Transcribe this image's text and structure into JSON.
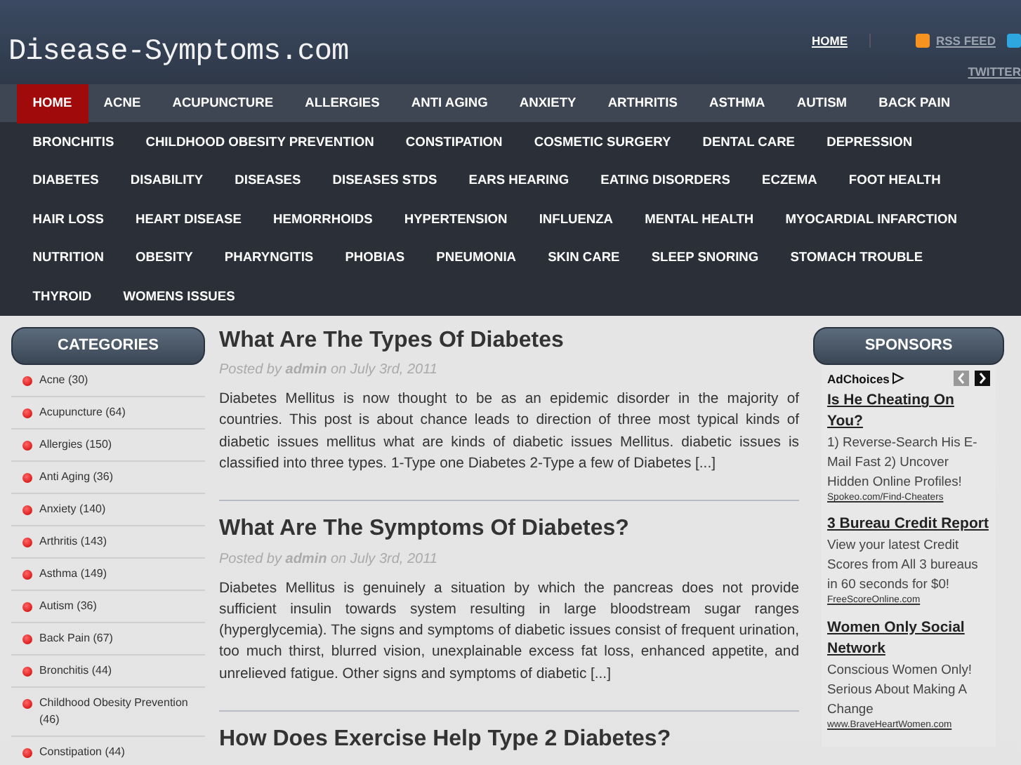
{
  "header": {
    "logo": "Disease-Symptoms.com",
    "top_links": [
      {
        "label": "HOME",
        "kind": "text"
      },
      {
        "label": "RSS FEED",
        "kind": "rss"
      },
      {
        "label": "TWITTER",
        "kind": "twitter"
      }
    ]
  },
  "nav": [
    {
      "label": "HOME",
      "selected": true
    },
    {
      "label": "ACNE",
      "selected": false
    },
    {
      "label": "ACUPUNCTURE",
      "selected": false
    },
    {
      "label": "ALLERGIES",
      "selected": false
    },
    {
      "label": "ANTI AGING",
      "selected": false
    },
    {
      "label": "ANXIETY",
      "selected": false
    },
    {
      "label": "ARTHRITIS",
      "selected": false
    },
    {
      "label": "ASTHMA",
      "selected": false
    },
    {
      "label": "AUTISM",
      "selected": false
    },
    {
      "label": "BACK PAIN",
      "selected": false
    },
    {
      "label": "BRONCHITIS",
      "selected": false
    },
    {
      "label": "CHILDHOOD OBESITY PREVENTION",
      "selected": false
    },
    {
      "label": "CONSTIPATION",
      "selected": false
    },
    {
      "label": "COSMETIC SURGERY",
      "selected": false
    },
    {
      "label": "DENTAL CARE",
      "selected": false
    },
    {
      "label": "DEPRESSION",
      "selected": false
    },
    {
      "label": "DIABETES",
      "selected": false
    },
    {
      "label": "DISABILITY",
      "selected": false
    },
    {
      "label": "DISEASES",
      "selected": false
    },
    {
      "label": "DISEASES STDS",
      "selected": false
    },
    {
      "label": "EARS HEARING",
      "selected": false
    },
    {
      "label": "EATING DISORDERS",
      "selected": false
    },
    {
      "label": "ECZEMA",
      "selected": false
    },
    {
      "label": "FOOT HEALTH",
      "selected": false
    },
    {
      "label": "HAIR LOSS",
      "selected": false
    },
    {
      "label": "HEART DISEASE",
      "selected": false
    },
    {
      "label": "HEMORRHOIDS",
      "selected": false
    },
    {
      "label": "HYPERTENSION",
      "selected": false
    },
    {
      "label": "INFLUENZA",
      "selected": false
    },
    {
      "label": "MENTAL HEALTH",
      "selected": false
    },
    {
      "label": "MYOCARDIAL INFARCTION",
      "selected": false
    },
    {
      "label": "NUTRITION",
      "selected": false
    },
    {
      "label": "OBESITY",
      "selected": false
    },
    {
      "label": "PHARYNGITIS",
      "selected": false
    },
    {
      "label": "PHOBIAS",
      "selected": false
    },
    {
      "label": "PNEUMONIA",
      "selected": false
    },
    {
      "label": "SKIN CARE",
      "selected": false
    },
    {
      "label": "SLEEP SNORING",
      "selected": false
    },
    {
      "label": "STOMACH TROUBLE",
      "selected": false
    },
    {
      "label": "THYROID",
      "selected": false
    },
    {
      "label": "WOMENS ISSUES",
      "selected": false
    }
  ],
  "categories": {
    "title": "CATEGORIES",
    "items": [
      "Acne (30)",
      "Acupuncture (64)",
      "Allergies (150)",
      "Anti Aging (36)",
      "Anxiety (140)",
      "Arthritis (143)",
      "Asthma (149)",
      "Autism (36)",
      "Back Pain (67)",
      "Bronchitis (44)",
      "Childhood Obesity Prevention (46)",
      "Constipation (44)"
    ]
  },
  "posts": [
    {
      "title": "What Are The Types Of Diabetes",
      "meta": "Posted by **admin** on July 3rd, 2011",
      "excerpt": "Diabetes Mellitus is now thought to be as an epidemic disorder in the majority of countries. This post is about chance leads to direction of three most typical kinds of diabetic issues mellitus what are kinds of diabetic issues Mellitus. diabetic issues is classified into three types. 1-Type one Diabetes 2-Type a few of Diabetes [...]"
    },
    {
      "title": "What Are The Symptoms Of Diabetes?",
      "meta": "Posted by **admin** on July 3rd, 2011",
      "excerpt": "Diabetes Mellitus is genuinely a situation by which the pancreas does not provide sufficient insulin towards system resulting in large bloodstream sugar ranges (hyperglycemia). The signs and symptoms of diabetic issues consist of frequent urination, too much thirst, blurred vision, unexplainable excess fat loss, enhanced appetite, and unrelieved fatigue. Other signs and symptoms of diabetic [...]"
    },
    {
      "title": "How Does Exercise Help Type 2 Diabetes?"
    }
  ],
  "sponsors": {
    "title": "SPONSORS",
    "adchoices": "AdChoices",
    "ads": [
      {
        "title": "Is He Cheating On You?",
        "text": "1) Reverse-Search His E-Mail Fast 2) Uncover Hidden Online Profiles!",
        "url": "Spokeo.com/Find-Cheaters"
      },
      {
        "title": "3 Bureau Credit Report",
        "text": "View your latest Credit Scores from All 3 bureaus in 60 seconds for $0!",
        "url": "FreeScoreOnline.com"
      },
      {
        "title": "Women Only Social Network",
        "text": "Conscious Women Only! Serious About Making A Change",
        "url": "www.BraveHeartWomen.com"
      }
    ]
  }
}
